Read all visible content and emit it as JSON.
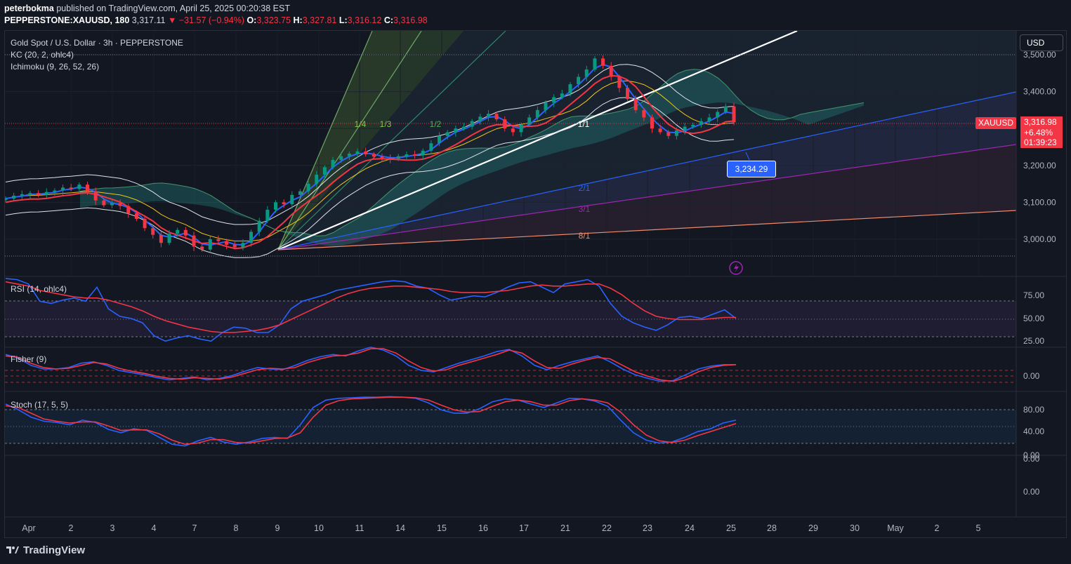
{
  "header": {
    "author": "peterbokma",
    "published": "published on TradingView.com, April 25, 2025 00:20:38 EST",
    "symbol": "PEPPERSTONE:XAUUSD, 180",
    "last": "3,317.11",
    "change": "▼ −31.57 (−0.94%)",
    "o_label": "O:",
    "o_value": "3,323.75",
    "h_label": "H:",
    "h_value": "3,327.81",
    "l_label": "L:",
    "l_value": "3,316.12",
    "c_label": "C:",
    "c_value": "3,316.98"
  },
  "legend": {
    "title": "Gold Spot / U.S. Dollar · 3h · PEPPERSTONE",
    "kc": "KC (20, 2, ohlc4)",
    "ichimoku": "Ichimoku (9, 26, 52, 26)"
  },
  "currency_button": "USD",
  "price_tag": {
    "symbol": "XAUUSD",
    "price": "3,316.98",
    "change": "+6.48%",
    "countdown": "01:39:23"
  },
  "callout": "3,234.29",
  "footer": {
    "brand": "TradingView"
  },
  "colors": {
    "background": "#131722",
    "up": "#089981",
    "down": "#f23645",
    "blue": "#2962ff",
    "red_line": "#f23645",
    "yellow": "#f0c419"
  },
  "chart_data": [
    {
      "type": "candlestick",
      "name": "XAUUSD 3h",
      "y_ticks": [
        "3,500.00",
        "3,400.00",
        "3,300.00",
        "3,200.00",
        "3,100.00",
        "3,000.00"
      ],
      "ylim": [
        2950,
        3520
      ],
      "x_ticks": [
        "Apr",
        "2",
        "3",
        "4",
        "7",
        "8",
        "9",
        "10",
        "11",
        "14",
        "15",
        "16",
        "17",
        "21",
        "22",
        "23",
        "24",
        "25",
        "28",
        "29",
        "30",
        "May",
        "2",
        "5"
      ],
      "fan_labels": [
        "1/4",
        "1/3",
        "1/2",
        "1/1",
        "2/1",
        "3/1",
        "8/1"
      ],
      "close_series": [
        3110,
        3118,
        3122,
        3125,
        3120,
        3128,
        3132,
        3140,
        3136,
        3148,
        3130,
        3105,
        3092,
        3098,
        3090,
        3070,
        3055,
        3030,
        3012,
        2990,
        3015,
        3025,
        3010,
        2980,
        2972,
        3000,
        2995,
        2985,
        2978,
        2990,
        3020,
        3050,
        3080,
        3100,
        3095,
        3120,
        3130,
        3150,
        3175,
        3195,
        3215,
        3225,
        3232,
        3238,
        3230,
        3224,
        3220,
        3218,
        3225,
        3230,
        3228,
        3240,
        3260,
        3280,
        3290,
        3300,
        3305,
        3320,
        3332,
        3340,
        3325,
        3300,
        3290,
        3310,
        3330,
        3350,
        3370,
        3385,
        3395,
        3420,
        3440,
        3460,
        3490,
        3470,
        3440,
        3410,
        3380,
        3350,
        3330,
        3300,
        3290,
        3280,
        3295,
        3305,
        3310,
        3320,
        3330,
        3345,
        3360,
        3316.98
      ]
    },
    {
      "type": "line",
      "name": "RSI (14, ohlc4)",
      "y_ticks": [
        "75.00",
        "50.00",
        "25.00"
      ],
      "ylim": [
        20,
        85
      ],
      "series": [
        {
          "values": [
            83,
            82,
            78,
            62,
            60,
            63,
            65,
            62,
            75,
            55,
            48,
            46,
            42,
            30,
            25,
            28,
            30,
            27,
            25,
            33,
            38,
            37,
            33,
            33,
            40,
            55,
            62,
            65,
            68,
            72,
            74,
            76,
            78,
            80,
            81,
            80,
            76,
            74,
            68,
            63,
            65,
            67,
            66,
            70,
            75,
            79,
            80,
            75,
            70,
            78,
            80,
            82,
            76,
            60,
            48,
            42,
            38,
            35,
            40,
            47,
            48,
            46,
            50,
            54,
            46
          ]
        },
        {
          "values": [
            80,
            78,
            76,
            72,
            70,
            68,
            66,
            65,
            65,
            63,
            60,
            57,
            53,
            48,
            44,
            41,
            38,
            36,
            34,
            33,
            33,
            34,
            35,
            37,
            40,
            45,
            50,
            55,
            60,
            65,
            69,
            72,
            74,
            75,
            76,
            76,
            75,
            74,
            73,
            71,
            70,
            70,
            70,
            71,
            72,
            74,
            76,
            77,
            76,
            76,
            77,
            78,
            78,
            74,
            68,
            60,
            53,
            48,
            46,
            45,
            45,
            45,
            46,
            47,
            47
          ]
        }
      ]
    },
    {
      "type": "line",
      "name": "Fisher (9)",
      "y_ticks": [
        "0.00"
      ],
      "ylim": [
        -3,
        3
      ],
      "series": [
        {
          "values": [
            2.0,
            1.5,
            0.5,
            0.0,
            0.0,
            0.2,
            0.8,
            1.0,
            0.5,
            -0.2,
            -0.5,
            -0.8,
            -1.2,
            -1.5,
            -1.3,
            -1.1,
            -1.5,
            -1.3,
            -0.9,
            -0.3,
            0.2,
            0.0,
            -0.1,
            0.5,
            1.2,
            1.7,
            2.0,
            1.8,
            2.5,
            3.0,
            2.6,
            1.8,
            0.5,
            -0.2,
            -0.4,
            0.2,
            0.8,
            1.3,
            1.8,
            2.4,
            2.7,
            1.8,
            0.5,
            -0.1,
            0.5,
            1.0,
            1.4,
            1.8,
            1.0,
            0.0,
            -0.8,
            -1.3,
            -1.7,
            -1.6,
            -0.8,
            0.0,
            0.4,
            0.6,
            0.6
          ]
        },
        {
          "values": [
            1.8,
            1.6,
            0.8,
            0.2,
            0.0,
            0.1,
            0.5,
            0.9,
            0.7,
            0.1,
            -0.3,
            -0.6,
            -1.0,
            -1.3,
            -1.4,
            -1.2,
            -1.3,
            -1.4,
            -1.1,
            -0.6,
            -0.1,
            0.1,
            0.0,
            0.2,
            0.9,
            1.4,
            1.8,
            1.9,
            2.2,
            2.8,
            2.8,
            2.2,
            1.1,
            0.2,
            -0.3,
            -0.1,
            0.5,
            1.0,
            1.5,
            2.0,
            2.6,
            2.2,
            1.1,
            0.2,
            0.1,
            0.7,
            1.2,
            1.6,
            1.4,
            0.5,
            -0.4,
            -1.0,
            -1.5,
            -1.7,
            -1.2,
            -0.4,
            0.2,
            0.5,
            0.6
          ]
        }
      ]
    },
    {
      "type": "line",
      "name": "Stoch (17, 5, 5)",
      "y_ticks": [
        "80.00",
        "40.00",
        "0.00"
      ],
      "ylim": [
        0,
        110
      ],
      "series": [
        {
          "values": [
            88,
            78,
            65,
            58,
            56,
            52,
            60,
            56,
            44,
            38,
            45,
            42,
            30,
            18,
            15,
            24,
            30,
            22,
            18,
            22,
            28,
            30,
            28,
            52,
            82,
            95,
            98,
            99,
            100,
            100,
            101,
            100,
            98,
            90,
            78,
            72,
            72,
            80,
            92,
            97,
            95,
            88,
            82,
            90,
            98,
            97,
            93,
            84,
            60,
            38,
            25,
            20,
            22,
            30,
            40,
            45,
            55,
            60
          ]
        },
        {
          "values": [
            85,
            82,
            72,
            62,
            58,
            55,
            57,
            57,
            50,
            42,
            43,
            43,
            36,
            25,
            18,
            20,
            26,
            26,
            21,
            20,
            24,
            28,
            29,
            38,
            65,
            86,
            94,
            97,
            98,
            99,
            100,
            100,
            99,
            95,
            86,
            78,
            74,
            75,
            84,
            92,
            95,
            92,
            86,
            86,
            94,
            97,
            95,
            90,
            74,
            52,
            34,
            24,
            21,
            25,
            33,
            40,
            47,
            54
          ]
        }
      ]
    },
    {
      "type": "line",
      "name": "empty-pane",
      "y_ticks": [
        "0.00",
        "0.00"
      ],
      "ylim": [
        -1,
        1
      ]
    }
  ]
}
